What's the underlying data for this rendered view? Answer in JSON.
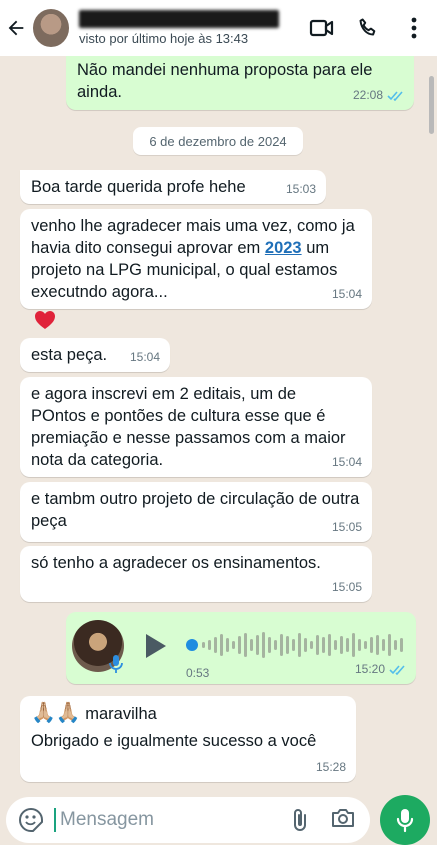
{
  "header": {
    "status": "visto por último hoje às 13:43"
  },
  "date_chip": "6 de dezembro de 2024",
  "messages": [
    {
      "text": "Não mandei nenhuma proposta para ele ainda.",
      "time": "22:08"
    },
    {
      "text": "Boa tarde querida profe hehe",
      "time": "15:03"
    },
    {
      "text_before": "venho lhe agradecer mais uma vez, como ja havia dito consegui aprovar em ",
      "link": "2023",
      "text_after": " um projeto na LPG municipal, o qual estamos executndo agora...",
      "time": "15:04"
    },
    {
      "reaction": "❤️"
    },
    {
      "text": "esta peça.",
      "time": "15:04"
    },
    {
      "text": "e agora inscrevi em 2 editais, um de POntos e pontões de cultura esse que é premiação e nesse passamos com a maior nota da categoria.",
      "time": "15:04"
    },
    {
      "text": "e tambm outro projeto de circulação de outra peça",
      "time": "15:05"
    },
    {
      "text": "só tenho a agradecer os ensinamentos.",
      "time": "15:05"
    },
    {
      "audio_duration": "0:53",
      "time": "15:20"
    },
    {
      "emoji": "🙏🏼🙏🏼",
      "text": "maravilha",
      "text2": "Obrigado e igualmente sucesso a você",
      "time": "15:28"
    }
  ],
  "input": {
    "placeholder": "Mensagem"
  },
  "colors": {
    "header_bg": "#ffffff",
    "chat_bg": "#efe7de",
    "outgoing_bubble": "#d8fdd2",
    "incoming_bubble": "#ffffff",
    "read_ticks": "#53bdeb",
    "mic_button": "#1daa61",
    "link": "#1f6fb8"
  },
  "icons": [
    "back-arrow-icon",
    "video-call-icon",
    "phone-icon",
    "more-vert-icon",
    "double-check-icon",
    "play-icon",
    "mic-icon",
    "sticker-icon",
    "attach-icon",
    "camera-icon"
  ]
}
